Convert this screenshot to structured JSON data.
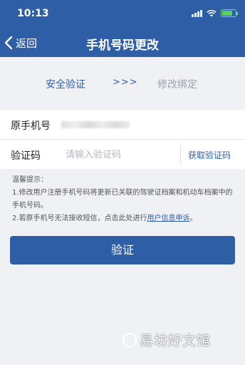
{
  "status": {
    "time": "10:13",
    "battery_level": 0.8,
    "battery_color": "#59d15b"
  },
  "nav": {
    "back_label": "返回",
    "title": "手机号码更改",
    "bg_color": "#2d5ea6"
  },
  "steps": {
    "step1": "安全验证",
    "arrow": ">>>",
    "step2": "修改绑定"
  },
  "form": {
    "phone_label": "原手机号",
    "code_label": "验证码",
    "code_placeholder": "请输入验证码",
    "get_code_label": "获取验证码"
  },
  "tips": {
    "title": "温馨提示：",
    "line1": "1.修改用户注册手机号码将更新已关联的驾驶证档案和机动车档案中的手机号码。",
    "line2_prefix": "2.若原手机号无法接收短信，点击此处进行",
    "line2_link": "用户信息申诉",
    "line2_suffix": "。"
  },
  "submit_label": "验证",
  "watermark": "易坊好文馆"
}
